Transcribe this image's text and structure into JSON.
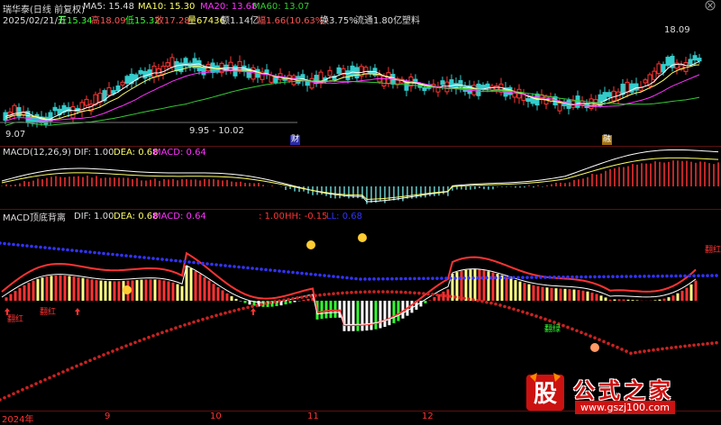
{
  "header": {
    "title": "瑞华泰(日线 前复权)",
    "ma": [
      {
        "label": "MA5: 15.48",
        "color": "#ffffff"
      },
      {
        "label": "MA10: 15.30",
        "color": "#ffff66"
      },
      {
        "label": "MA20: 13.68",
        "color": "#ff33ff"
      },
      {
        "label": "MA60: 13.07",
        "color": "#33cc33"
      }
    ],
    "quote": {
      "date": "2025/02/21/五",
      "open": "开15.34",
      "high": "高18.09",
      "low": "低15.32",
      "close": "收17.28",
      "volume": "量67436",
      "amount": "额1.14亿",
      "change": "幅1.66(10.63%)",
      "turnover": "换3.75%",
      "float": "流通1.80亿",
      "industry": "塑料"
    }
  },
  "price_panel": {
    "high_label": "18.09",
    "low_label": "9.07",
    "range_label": "9.95 - 10.02",
    "markers": [
      "财",
      "融"
    ]
  },
  "macd_panel": {
    "title": "MACD(12,26,9)",
    "dif": "DIF: 1.00",
    "dea": "DEA: 0.68",
    "macd": "MACD: 0.64"
  },
  "custom_panel": {
    "title": "MACD顶底背离",
    "dif": "DIF: 1.00",
    "dea": "DEA: 0.68",
    "macd": "MACD: 0.64",
    "extra": ": 1.00",
    "hh": "HH: -0.15",
    "ll": "LL: 0.68",
    "tags": [
      "翻红",
      "翻红",
      "翻绿",
      "翻红"
    ]
  },
  "x_axis": {
    "labels": [
      "2024年",
      "9",
      "10",
      "11",
      "12"
    ]
  },
  "watermark": {
    "icon": "gu-logo",
    "brand": "公式之家",
    "url": "www.gszj100.com"
  },
  "colors": {
    "background": "#000000",
    "up": "#ff3333",
    "down": "#33cccc",
    "ma5": "#ffffff",
    "ma10": "#ffff66",
    "ma20": "#ff33ff",
    "ma60": "#33cc33",
    "trend": "#2b2bd9",
    "trend_low": "#cc2222"
  }
}
